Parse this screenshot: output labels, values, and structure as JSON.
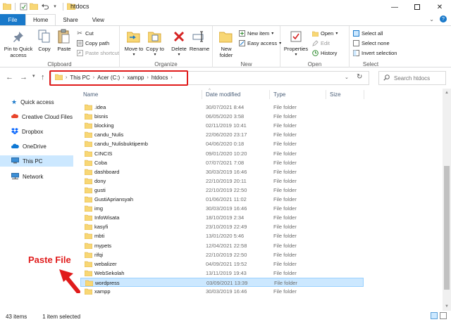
{
  "window": {
    "title": "htdocs",
    "controls": [
      "minimize-icon",
      "maximize-icon",
      "close-icon"
    ]
  },
  "ribbon_tabs": [
    "File",
    "Home",
    "Share",
    "View"
  ],
  "ribbon": {
    "clipboard": {
      "label": "Clipboard",
      "pin": "Pin to Quick access",
      "copy": "Copy",
      "paste": "Paste",
      "cut": "Cut",
      "copy_path": "Copy path",
      "paste_shortcut": "Paste shortcut"
    },
    "organize": {
      "label": "Organize",
      "move_to": "Move to",
      "copy_to": "Copy to",
      "delete": "Delete",
      "rename": "Rename"
    },
    "new": {
      "label": "New",
      "new_folder": "New folder",
      "new_item": "New item",
      "easy_access": "Easy access"
    },
    "open": {
      "label": "Open",
      "properties": "Properties",
      "open": "Open",
      "edit": "Edit",
      "history": "History"
    },
    "select": {
      "label": "Select",
      "select_all": "Select all",
      "select_none": "Select none",
      "invert_selection": "Invert selection"
    }
  },
  "address": {
    "crumbs": [
      "This PC",
      "Acer (C:)",
      "xampp",
      "htdocs"
    ],
    "search_placeholder": "Search htdocs"
  },
  "sidebar": {
    "items": [
      {
        "label": "Quick access",
        "icon": "star-icon"
      },
      {
        "label": "Creative Cloud Files",
        "icon": "creative-cloud-icon"
      },
      {
        "label": "Dropbox",
        "icon": "dropbox-icon"
      },
      {
        "label": "OneDrive",
        "icon": "cloud-icon"
      },
      {
        "label": "This PC",
        "icon": "computer-icon",
        "selected": true
      },
      {
        "label": "Network",
        "icon": "network-icon"
      }
    ]
  },
  "columns": {
    "name": "Name",
    "date": "Date modified",
    "type": "Type",
    "size": "Size"
  },
  "files": [
    {
      "name": ".idea",
      "date": "30/07/2021 8:44",
      "type": "File folder"
    },
    {
      "name": "bisnis",
      "date": "06/05/2020 3:58",
      "type": "File folder"
    },
    {
      "name": "blocking",
      "date": "02/11/2019 10:41",
      "type": "File folder"
    },
    {
      "name": "candu_Nulis",
      "date": "22/06/2020 23:17",
      "type": "File folder"
    },
    {
      "name": "candu_Nulisbuktipemb",
      "date": "04/06/2020 0:18",
      "type": "File folder"
    },
    {
      "name": "CINCIS",
      "date": "09/01/2020 10:20",
      "type": "File folder"
    },
    {
      "name": "Coba",
      "date": "07/07/2021 7:08",
      "type": "File folder"
    },
    {
      "name": "dashboard",
      "date": "30/03/2019 16:46",
      "type": "File folder"
    },
    {
      "name": "dony",
      "date": "22/10/2019 20:11",
      "type": "File folder"
    },
    {
      "name": "gusti",
      "date": "22/10/2019 22:50",
      "type": "File folder"
    },
    {
      "name": "GustiApriansyah",
      "date": "01/06/2021 11:02",
      "type": "File folder"
    },
    {
      "name": "img",
      "date": "30/03/2019 16:46",
      "type": "File folder"
    },
    {
      "name": "InfoWisata",
      "date": "18/10/2019 2:34",
      "type": "File folder"
    },
    {
      "name": "kasyfi",
      "date": "23/10/2019 22:49",
      "type": "File folder"
    },
    {
      "name": "mbti",
      "date": "13/01/2020 5:46",
      "type": "File folder"
    },
    {
      "name": "mypets",
      "date": "12/04/2021 22:58",
      "type": "File folder"
    },
    {
      "name": "rifqi",
      "date": "22/10/2019 22:50",
      "type": "File folder"
    },
    {
      "name": "webalizer",
      "date": "04/09/2021 19:52",
      "type": "File folder"
    },
    {
      "name": "WebSekolah",
      "date": "13/11/2019 19:43",
      "type": "File folder"
    },
    {
      "name": "wordpress",
      "date": "03/09/2021 13:39",
      "type": "File folder",
      "selected": true
    },
    {
      "name": "xampp",
      "date": "30/03/2019 16:46",
      "type": "File folder"
    }
  ],
  "status": {
    "item_count": "43 items",
    "selection": "1 item selected"
  },
  "annotation": {
    "text": "Paste File"
  },
  "colors": {
    "accent": "#1979ca",
    "highlight": "#e01b1b",
    "selection": "#cce8ff",
    "folder": "#f8d775"
  }
}
